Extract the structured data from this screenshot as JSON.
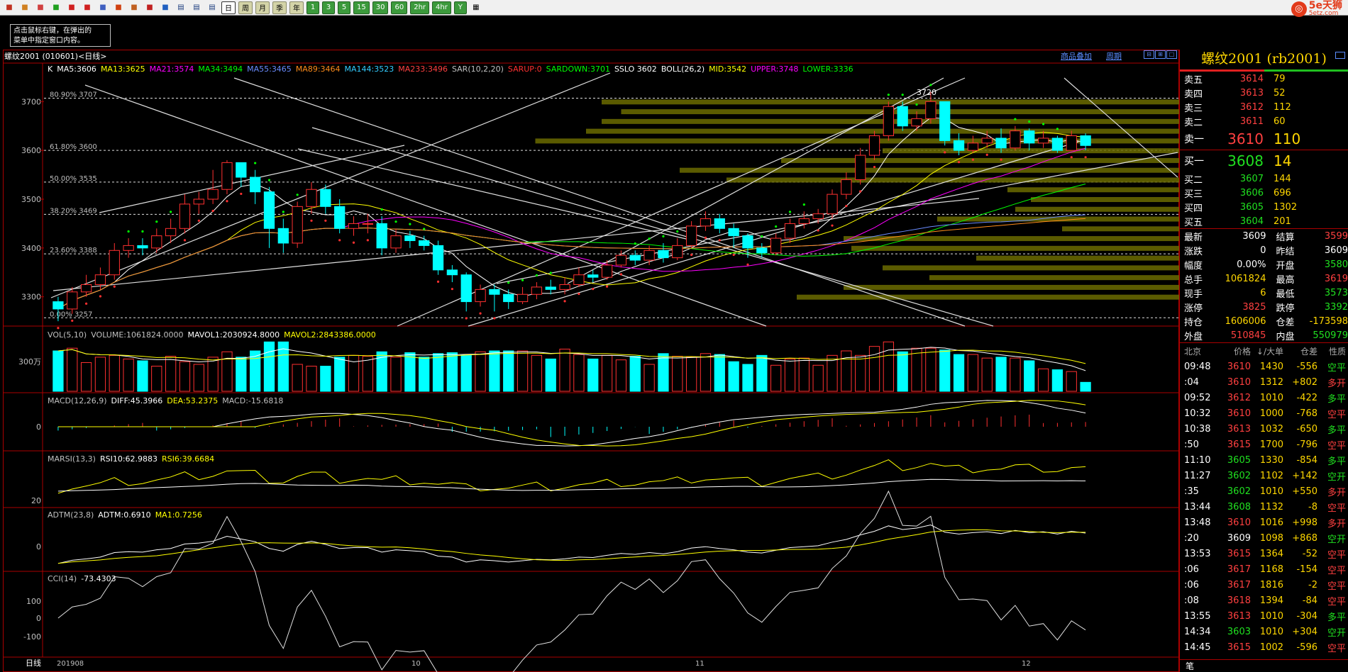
{
  "toolbar": {
    "periods": [
      "日",
      "周",
      "月",
      "季",
      "年",
      "1",
      "3",
      "5",
      "15",
      "30",
      "60",
      "2hr",
      "4hr",
      "Y"
    ],
    "active": "日"
  },
  "logo": {
    "main": "5e天狮",
    "sub": "5etz.com"
  },
  "hint": {
    "line1": "点击鼠标右键，在弹出的",
    "line2": "菜单中指定窗口内容。"
  },
  "chart": {
    "title": "螺纹2001 (010601)<日线>",
    "links": [
      "商品叠加",
      "周期"
    ],
    "ma_header": [
      {
        "t": "K",
        "c": "#ffffff"
      },
      {
        "t": "MA5:3606",
        "c": "#ffffff"
      },
      {
        "t": "MA13:3625",
        "c": "#ffff00"
      },
      {
        "t": "MA21:3574",
        "c": "#ff00ff"
      },
      {
        "t": "MA34:3494",
        "c": "#00ff00"
      },
      {
        "t": "MA55:3465",
        "c": "#6a8cff"
      },
      {
        "t": "MA89:3464",
        "c": "#ff8c1a"
      },
      {
        "t": "MA144:3523",
        "c": "#33ccff"
      },
      {
        "t": "MA233:3496",
        "c": "#ff4040"
      },
      {
        "t": "SAR(10,2,20)",
        "c": "#c0c0c0"
      },
      {
        "t": "SARUP:0",
        "c": "#ff3030"
      },
      {
        "t": "SARDOWN:3701",
        "c": "#00ff00"
      },
      {
        "t": "SSLO 3602",
        "c": "#ffffff"
      },
      {
        "t": "BOLL(26,2)",
        "c": "#ffffff"
      },
      {
        "t": "MID:3542",
        "c": "#ffff00"
      },
      {
        "t": "UPPER:3748",
        "c": "#ff00ff"
      },
      {
        "t": "LOWER:3336",
        "c": "#00ff00"
      }
    ],
    "y_labels": [
      "3700",
      "3600",
      "3500",
      "3400",
      "3300"
    ],
    "fib_labels": [
      "80.90% 3707",
      "61.80% 3600",
      "50.00% 3535",
      "38.20% 3469",
      "23.60% 3388",
      "0.00% 3257"
    ],
    "peak_label": "3720",
    "vol_header": [
      {
        "t": "VOL(5,10)",
        "c": "#c0c0c0"
      },
      {
        "t": "VOLUME:1061824.0000",
        "c": "#c0c0c0"
      },
      {
        "t": "MAVOL1:2030924.8000",
        "c": "#ffffff"
      },
      {
        "t": "MAVOL2:2843386.0000",
        "c": "#ffff00"
      }
    ],
    "vol_label": "300万",
    "macd_header": [
      {
        "t": "MACD(12,26,9)",
        "c": "#c0c0c0"
      },
      {
        "t": "DIFF:45.3966",
        "c": "#ffffff"
      },
      {
        "t": "DEA:53.2375",
        "c": "#ffff00"
      },
      {
        "t": "MACD:-15.6818",
        "c": "#c0c0c0"
      }
    ],
    "macd_label": "0",
    "rsi_header": [
      {
        "t": "MARSI(13,3)",
        "c": "#c0c0c0"
      },
      {
        "t": "RSI10:62.9883",
        "c": "#ffffff"
      },
      {
        "t": "RSI6:39.6684",
        "c": "#ffff00"
      }
    ],
    "rsi_label": "20",
    "adtm_header": [
      {
        "t": "ADTM(23,8)",
        "c": "#c0c0c0"
      },
      {
        "t": "ADTM:0.6910",
        "c": "#ffffff"
      },
      {
        "t": "MA1:0.7256",
        "c": "#ffff00"
      }
    ],
    "adtm_label": "0",
    "cci_header": [
      {
        "t": "CCI(14)",
        "c": "#c0c0c0"
      },
      {
        "t": "-73.4303",
        "c": "#ffffff"
      }
    ],
    "cci_labels": [
      "100",
      "0",
      "-100"
    ],
    "x_labels": [
      "201908",
      "10",
      "11",
      "12"
    ],
    "x_mode": "日线"
  },
  "chart_data": {
    "type": "candlestick",
    "title": "螺纹2001 (010601)<日线>",
    "ylim": [
      3240,
      3760
    ],
    "x_ticks": [
      "201908",
      "10",
      "11",
      "12"
    ],
    "ohlc": [
      [
        3290,
        3275,
        3250,
        3300
      ],
      [
        3275,
        3310,
        3265,
        3320
      ],
      [
        3310,
        3325,
        3300,
        3345
      ],
      [
        3325,
        3345,
        3315,
        3360
      ],
      [
        3345,
        3395,
        3335,
        3410
      ],
      [
        3395,
        3405,
        3380,
        3420
      ],
      [
        3405,
        3400,
        3385,
        3420
      ],
      [
        3400,
        3425,
        3390,
        3440
      ],
      [
        3425,
        3440,
        3410,
        3460
      ],
      [
        3440,
        3490,
        3430,
        3510
      ],
      [
        3490,
        3500,
        3470,
        3515
      ],
      [
        3500,
        3520,
        3490,
        3560
      ],
      [
        3520,
        3575,
        3510,
        3580
      ],
      [
        3575,
        3545,
        3525,
        3575
      ],
      [
        3545,
        3515,
        3490,
        3560
      ],
      [
        3515,
        3440,
        3400,
        3525
      ],
      [
        3440,
        3410,
        3390,
        3460
      ],
      [
        3410,
        3485,
        3400,
        3495
      ],
      [
        3485,
        3520,
        3470,
        3535
      ],
      [
        3520,
        3485,
        3470,
        3530
      ],
      [
        3485,
        3440,
        3430,
        3500
      ],
      [
        3440,
        3450,
        3425,
        3465
      ],
      [
        3450,
        3450,
        3430,
        3470
      ],
      [
        3450,
        3400,
        3385,
        3465
      ],
      [
        3400,
        3425,
        3390,
        3440
      ],
      [
        3425,
        3415,
        3400,
        3435
      ],
      [
        3415,
        3405,
        3395,
        3425
      ],
      [
        3405,
        3355,
        3345,
        3415
      ],
      [
        3355,
        3345,
        3330,
        3365
      ],
      [
        3345,
        3290,
        3270,
        3350
      ],
      [
        3290,
        3315,
        3280,
        3325
      ],
      [
        3315,
        3305,
        3270,
        3325
      ],
      [
        3305,
        3290,
        3275,
        3315
      ],
      [
        3290,
        3305,
        3285,
        3320
      ],
      [
        3305,
        3320,
        3295,
        3330
      ],
      [
        3320,
        3315,
        3305,
        3335
      ],
      [
        3315,
        3325,
        3305,
        3340
      ],
      [
        3325,
        3345,
        3320,
        3360
      ],
      [
        3345,
        3340,
        3330,
        3355
      ],
      [
        3340,
        3365,
        3335,
        3375
      ],
      [
        3365,
        3385,
        3360,
        3395
      ],
      [
        3385,
        3375,
        3365,
        3395
      ],
      [
        3375,
        3395,
        3365,
        3405
      ],
      [
        3395,
        3380,
        3370,
        3410
      ],
      [
        3380,
        3405,
        3375,
        3420
      ],
      [
        3405,
        3445,
        3400,
        3455
      ],
      [
        3445,
        3460,
        3435,
        3475
      ],
      [
        3460,
        3440,
        3430,
        3470
      ],
      [
        3440,
        3425,
        3400,
        3450
      ],
      [
        3425,
        3400,
        3380,
        3430
      ],
      [
        3400,
        3390,
        3380,
        3410
      ],
      [
        3390,
        3420,
        3385,
        3430
      ],
      [
        3420,
        3450,
        3410,
        3460
      ],
      [
        3450,
        3460,
        3440,
        3475
      ],
      [
        3460,
        3470,
        3450,
        3480
      ],
      [
        3470,
        3510,
        3460,
        3520
      ],
      [
        3510,
        3540,
        3500,
        3555
      ],
      [
        3540,
        3590,
        3530,
        3605
      ],
      [
        3590,
        3630,
        3580,
        3640
      ],
      [
        3630,
        3690,
        3620,
        3700
      ],
      [
        3690,
        3650,
        3640,
        3700
      ],
      [
        3650,
        3665,
        3640,
        3680
      ],
      [
        3665,
        3700,
        3655,
        3720
      ],
      [
        3700,
        3620,
        3610,
        3700
      ],
      [
        3620,
        3600,
        3590,
        3635
      ],
      [
        3600,
        3615,
        3595,
        3630
      ],
      [
        3615,
        3625,
        3605,
        3640
      ],
      [
        3625,
        3605,
        3595,
        3645
      ],
      [
        3605,
        3640,
        3600,
        3650
      ],
      [
        3640,
        3615,
        3600,
        3645
      ],
      [
        3615,
        3625,
        3605,
        3640
      ],
      [
        3625,
        3600,
        3595,
        3630
      ],
      [
        3600,
        3630,
        3600,
        3640
      ],
      [
        3630,
        3610,
        3600,
        3635
      ]
    ],
    "volume": [
      45,
      48,
      32,
      38,
      40,
      36,
      34,
      28,
      39,
      33,
      30,
      38,
      44,
      38,
      45,
      55,
      55,
      30,
      28,
      28,
      38,
      40,
      39,
      44,
      38,
      43,
      38,
      42,
      43,
      40,
      44,
      45,
      45,
      45,
      40,
      36,
      47,
      41,
      36,
      40,
      35,
      39,
      30,
      42,
      39,
      38,
      42,
      41,
      33,
      30,
      40,
      29,
      36,
      37,
      29,
      40,
      45,
      40,
      50,
      55,
      44,
      48,
      48,
      46,
      41,
      41,
      37,
      38,
      37,
      34,
      25,
      24,
      22,
      10
    ],
    "indicators": {
      "MA5": 3606,
      "MA13": 3625,
      "MA21": 3574,
      "MA34": 3494,
      "MA55": 3465,
      "MA89": 3464,
      "MA144": 3523,
      "MA233": 3496,
      "SARDOWN": 3701,
      "MID": 3542,
      "UPPER": 3748,
      "LOWER": 3336,
      "DIFF": 45.3966,
      "DEA": 53.2375,
      "MACD": -15.6818,
      "RSI10": 62.9883,
      "RSI6": 39.6684,
      "ADTM": 0.691,
      "ADTM_MA1": 0.7256,
      "CCI": -73.4303
    }
  },
  "quote": {
    "title": "螺纹2001 (rb2001)",
    "asks": [
      {
        "label": "卖五",
        "price": "3614",
        "vol": "79"
      },
      {
        "label": "卖四",
        "price": "3613",
        "vol": "52"
      },
      {
        "label": "卖三",
        "price": "3612",
        "vol": "112"
      },
      {
        "label": "卖二",
        "price": "3611",
        "vol": "60"
      },
      {
        "label": "卖一",
        "price": "3610",
        "vol": "110"
      }
    ],
    "bids": [
      {
        "label": "买一",
        "price": "3608",
        "vol": "14"
      },
      {
        "label": "买二",
        "price": "3607",
        "vol": "144"
      },
      {
        "label": "买三",
        "price": "3606",
        "vol": "696"
      },
      {
        "label": "买四",
        "price": "3605",
        "vol": "1302"
      },
      {
        "label": "买五",
        "price": "3604",
        "vol": "201"
      }
    ],
    "stats": [
      {
        "l1": "最新",
        "v1": "3609",
        "c1": "#ffffff",
        "l2": "结算",
        "v2": "3599",
        "c2": "#ff4040"
      },
      {
        "l1": "涨跌",
        "v1": "0",
        "c1": "#ffffff",
        "l2": "昨结",
        "v2": "3609",
        "c2": "#ffffff"
      },
      {
        "l1": "幅度",
        "v1": "0.00%",
        "c1": "#ffffff",
        "l2": "开盘",
        "v2": "3580",
        "c2": "#20e020"
      },
      {
        "l1": "总手",
        "v1": "1061824",
        "c1": "#ffd700",
        "l2": "最高",
        "v2": "3619",
        "c2": "#ff4040"
      },
      {
        "l1": "现手",
        "v1": "6",
        "c1": "#ffd700",
        "l2": "最低",
        "v2": "3573",
        "c2": "#20e020"
      },
      {
        "l1": "涨停",
        "v1": "3825",
        "c1": "#ff4040",
        "l2": "跌停",
        "v2": "3392",
        "c2": "#20e020"
      },
      {
        "l1": "持仓",
        "v1": "1606006",
        "c1": "#ffd700",
        "l2": "仓差",
        "v2": "-173598",
        "c2": "#ffd700"
      },
      {
        "l1": "外盘",
        "v1": "510845",
        "c1": "#ff4040",
        "l2": "内盘",
        "v2": "550979",
        "c2": "#20e020"
      }
    ],
    "trade_header": {
      "city": "北京",
      "price": "价格",
      "vol": "↓/大单",
      "oi": "仓差",
      "nat": "性质"
    },
    "trades": [
      {
        "t": "09:48",
        "p": "3610",
        "v": "1430",
        "d": "-556",
        "n": "空平",
        "pc": "#ff4040",
        "nc": "#20e020"
      },
      {
        "t": ":04",
        "p": "3610",
        "v": "1312",
        "d": "+802",
        "n": "多开",
        "pc": "#ff4040",
        "nc": "#ff4040"
      },
      {
        "t": "09:52",
        "p": "3612",
        "v": "1010",
        "d": "-422",
        "n": "多平",
        "pc": "#ff4040",
        "nc": "#20e020"
      },
      {
        "t": "10:32",
        "p": "3610",
        "v": "1000",
        "d": "-768",
        "n": "空平",
        "pc": "#ff4040",
        "nc": "#ff4040"
      },
      {
        "t": "10:38",
        "p": "3613",
        "v": "1032",
        "d": "-650",
        "n": "多平",
        "pc": "#ff4040",
        "nc": "#20e020"
      },
      {
        "t": ":50",
        "p": "3615",
        "v": "1700",
        "d": "-796",
        "n": "空平",
        "pc": "#ff4040",
        "nc": "#ff4040"
      },
      {
        "t": "11:10",
        "p": "3605",
        "v": "1330",
        "d": "-854",
        "n": "多平",
        "pc": "#20e020",
        "nc": "#20e020"
      },
      {
        "t": "11:27",
        "p": "3602",
        "v": "1102",
        "d": "+142",
        "n": "空开",
        "pc": "#20e020",
        "nc": "#20e020"
      },
      {
        "t": ":35",
        "p": "3602",
        "v": "1010",
        "d": "+550",
        "n": "多开",
        "pc": "#20e020",
        "nc": "#ff4040"
      },
      {
        "t": "13:44",
        "p": "3608",
        "v": "1132",
        "d": "-8",
        "n": "空平",
        "pc": "#20e020",
        "nc": "#ff4040"
      },
      {
        "t": "13:48",
        "p": "3610",
        "v": "1016",
        "d": "+998",
        "n": "多开",
        "pc": "#ff4040",
        "nc": "#ff4040"
      },
      {
        "t": ":20",
        "p": "3609",
        "v": "1098",
        "d": "+868",
        "n": "空开",
        "pc": "#ffffff",
        "nc": "#20e020"
      },
      {
        "t": "13:53",
        "p": "3615",
        "v": "1364",
        "d": "-52",
        "n": "空平",
        "pc": "#ff4040",
        "nc": "#ff4040"
      },
      {
        "t": ":06",
        "p": "3617",
        "v": "1168",
        "d": "-154",
        "n": "空平",
        "pc": "#ff4040",
        "nc": "#ff4040"
      },
      {
        "t": ":06",
        "p": "3617",
        "v": "1816",
        "d": "-2",
        "n": "空平",
        "pc": "#ff4040",
        "nc": "#ff4040"
      },
      {
        "t": ":08",
        "p": "3618",
        "v": "1394",
        "d": "-84",
        "n": "空平",
        "pc": "#ff4040",
        "nc": "#ff4040"
      },
      {
        "t": "13:55",
        "p": "3613",
        "v": "1010",
        "d": "-304",
        "n": "多平",
        "pc": "#ff4040",
        "nc": "#20e020"
      },
      {
        "t": "14:34",
        "p": "3603",
        "v": "1010",
        "d": "+304",
        "n": "空开",
        "pc": "#20e020",
        "nc": "#20e020"
      },
      {
        "t": "14:45",
        "p": "3615",
        "v": "1002",
        "d": "-596",
        "n": "空平",
        "pc": "#ff4040",
        "nc": "#ff4040"
      }
    ],
    "bottom": "笔"
  }
}
